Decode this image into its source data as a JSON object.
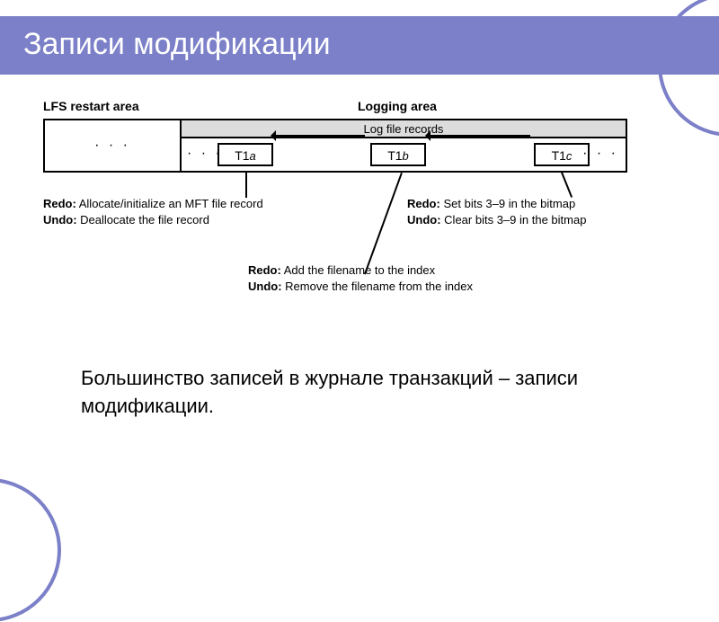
{
  "title": "Записи модификации",
  "labels": {
    "restart_area": "LFS restart area",
    "logging_area": "Logging area",
    "records_header": "Log file records",
    "ellipsis": "· · ·"
  },
  "records": {
    "a_prefix": "T1",
    "a_suffix": "a",
    "b_prefix": "T1",
    "b_suffix": "b",
    "c_prefix": "T1",
    "c_suffix": "c"
  },
  "annotations": {
    "a": {
      "redo_label": "Redo:",
      "redo_text": "Allocate/initialize an MFT file record",
      "undo_label": "Undo:",
      "undo_text": "Deallocate the file record"
    },
    "b": {
      "redo_label": "Redo:",
      "redo_text": "Add the filename to the index",
      "undo_label": "Undo:",
      "undo_text": "Remove the filename from the index"
    },
    "c": {
      "redo_label": "Redo:",
      "redo_text": "Set bits 3–9 in the bitmap",
      "undo_label": "Undo:",
      "undo_text": "Clear bits 3–9 in the bitmap"
    }
  },
  "body": "Большинство записей в журнале транзакций – записи модификации."
}
